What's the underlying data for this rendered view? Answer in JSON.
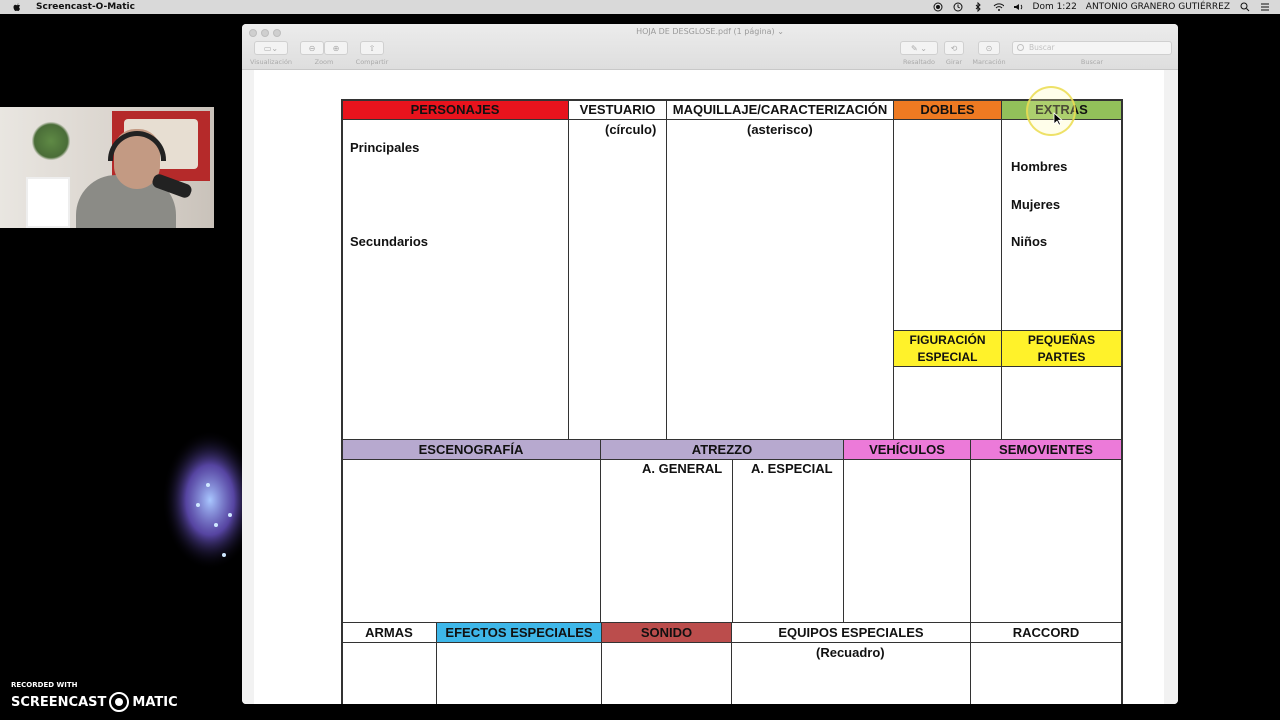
{
  "menubar": {
    "app_name": "Screencast-O-Matic",
    "clock": "Dom 1:22",
    "user": "ANTONIO GRANERO GUTIÉRREZ",
    "icons": [
      "apple-icon",
      "record-icon",
      "time-machine-icon",
      "bluetooth-icon",
      "wifi-icon",
      "volume-icon",
      "search-icon",
      "menu-icon"
    ]
  },
  "watermark": {
    "line1": "RECORDED WITH",
    "brand_a": "SCREENCAST",
    "brand_b": "MATIC"
  },
  "window": {
    "title": "HOJA DE DESGLOSE.pdf (1 página) ⌄",
    "toolbar": {
      "view_label": "Visualización",
      "zoom_label": "Zoom",
      "share_label": "Compartir",
      "highlight_label": "Resaltado",
      "rotate_label": "Girar",
      "markup_label": "Marcación",
      "search_label": "Buscar",
      "search_placeholder": "Buscar"
    }
  },
  "sheet": {
    "row1": {
      "personajes": "PERSONAJES",
      "vestuario": "VESTUARIO",
      "vestuario_sub": "(círculo)",
      "maquillaje": "MAQUILLAJE/CARACTERIZACIÓN",
      "maquillaje_sub": "(asterisco)",
      "dobles": "DOBLES",
      "extras": "EXTRAS",
      "principales": "Principales",
      "secundarios": "Secundarios",
      "hombres": "Hombres",
      "mujeres": "Mujeres",
      "ninos": "Niños",
      "figuracion_1": "FIGURACIÓN",
      "figuracion_2": "ESPECIAL",
      "pequenas_1": "PEQUEÑAS",
      "pequenas_2": "PARTES"
    },
    "row2": {
      "escenografia": "ESCENOGRAFÍA",
      "atrezzo": "ATREZZO",
      "general": "A. GENERAL",
      "especial": "A. ESPECIAL",
      "vehiculos": "VEHÍCULOS",
      "semovientes": "SEMOVIENTES"
    },
    "row3": {
      "armas": "ARMAS",
      "efectos": "EFECTOS ESPECIALES",
      "sonido": "SONIDO",
      "equipos": "EQUIPOS ESPECIALES",
      "equipos_sub": "(Recuadro)",
      "raccord": "RACCORD"
    }
  },
  "colors": {
    "personajes": "#e8131d",
    "dobles": "#ee7a22",
    "extras": "#92c15a",
    "figuracion": "#fff22a",
    "escenografia": "#b7a9cf",
    "atrezzo": "#b7a9cf",
    "vehiculos": "#ec7ad9",
    "semovientes": "#ec7ad9",
    "efectos": "#3eb7e9",
    "sonido": "#bb4d4c"
  }
}
